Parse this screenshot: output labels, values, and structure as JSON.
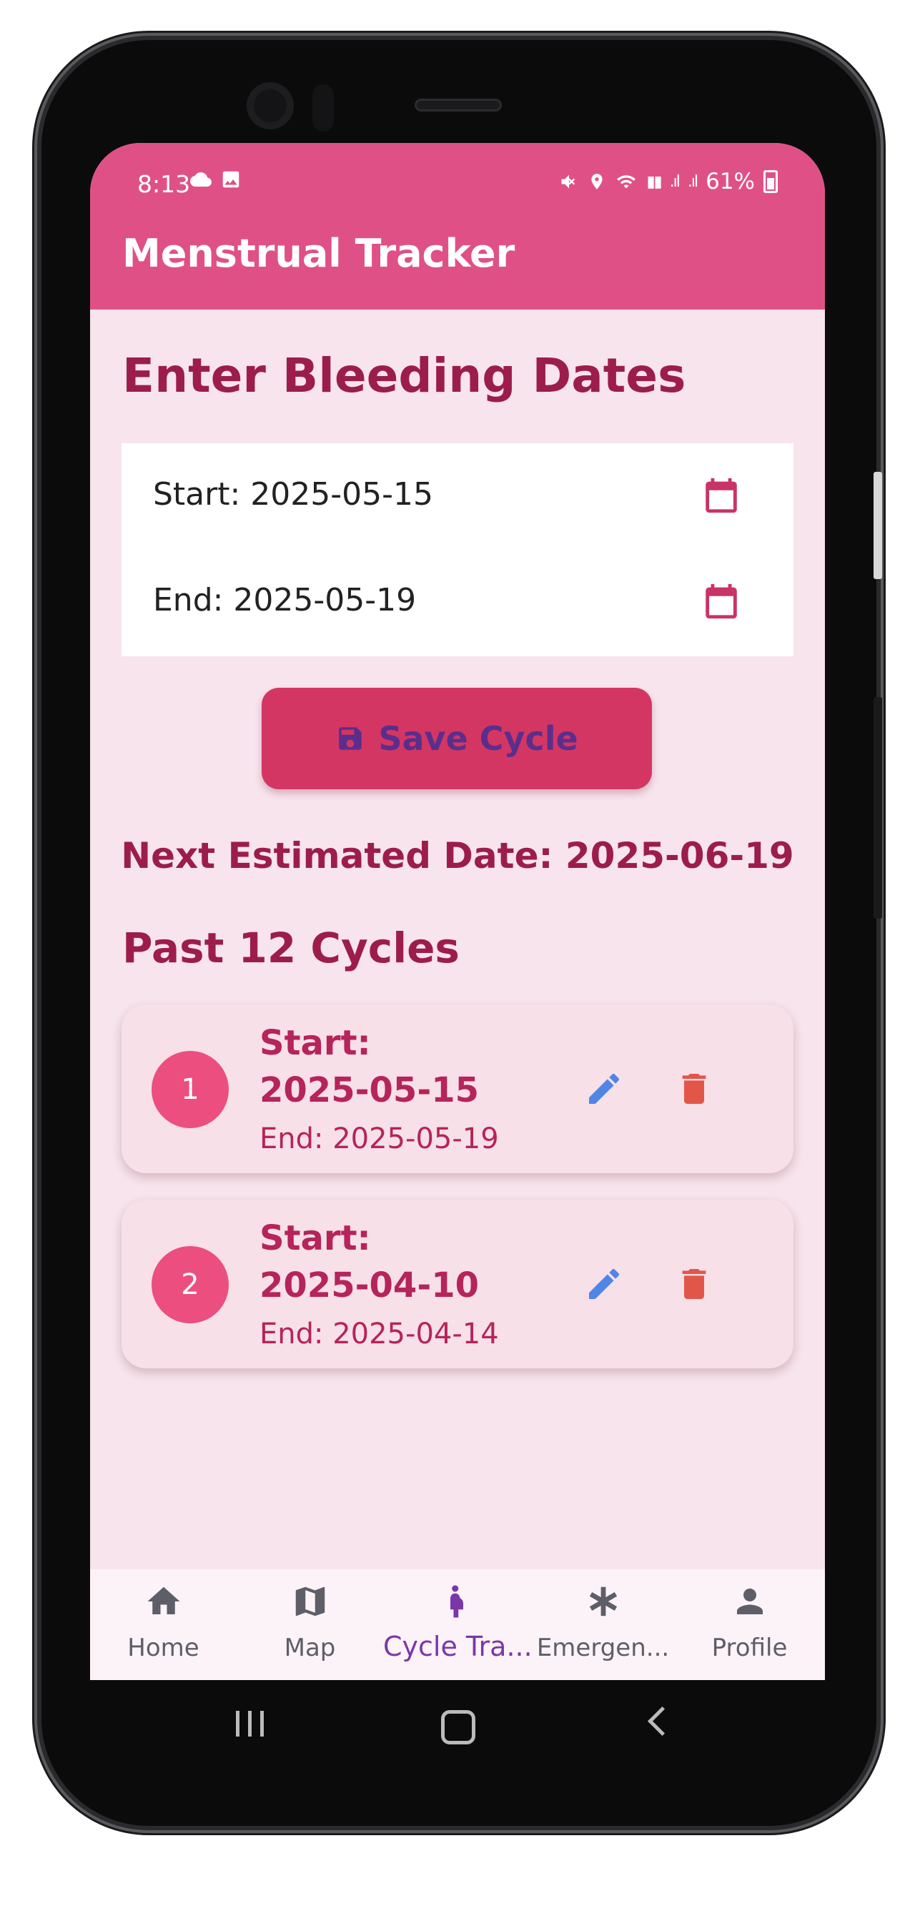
{
  "status_bar": {
    "time": "8:13",
    "left_icons": [
      "cloud-icon",
      "image-icon"
    ],
    "battery": "61%",
    "right_icons": [
      "mute-icon",
      "location-icon",
      "wifi-icon",
      "volte-icon",
      "signal-icon",
      "signal-icon",
      "battery-icon"
    ]
  },
  "app_bar": {
    "title": "Menstrual Tracker",
    "color": "#df5186"
  },
  "form": {
    "heading": "Enter Bleeding Dates",
    "start_text": "Start: 2025-05-15",
    "end_text": "End: 2025-05-19",
    "save_label": "Save Cycle",
    "next_estimated": "Next Estimated Date: 2025-06-19"
  },
  "past": {
    "heading": "Past 12 Cycles",
    "cycles": [
      {
        "index": "1",
        "start_label": "Start:",
        "start_date": "2025-05-15",
        "end_text": "End: 2025-05-19"
      },
      {
        "index": "2",
        "start_label": "Start:",
        "start_date": "2025-04-10",
        "end_text": "End: 2025-04-14"
      }
    ]
  },
  "bottom_nav": {
    "items": [
      {
        "label": "Home",
        "icon": "home-icon"
      },
      {
        "label": "Map",
        "icon": "map-icon"
      },
      {
        "label": "Cycle Tra...",
        "icon": "pregnant-woman-icon",
        "active": true
      },
      {
        "label": "Emergen...",
        "icon": "asterisk-icon"
      },
      {
        "label": "Profile",
        "icon": "person-icon"
      }
    ]
  },
  "colors": {
    "accent": "#df5186",
    "background": "#f7e4ec",
    "heading_text": "#9c1d4c",
    "save_button": "#d43663",
    "edit_icon": "#4f86e6",
    "delete_icon": "#e2564a",
    "nav_active": "#7b36a8"
  }
}
